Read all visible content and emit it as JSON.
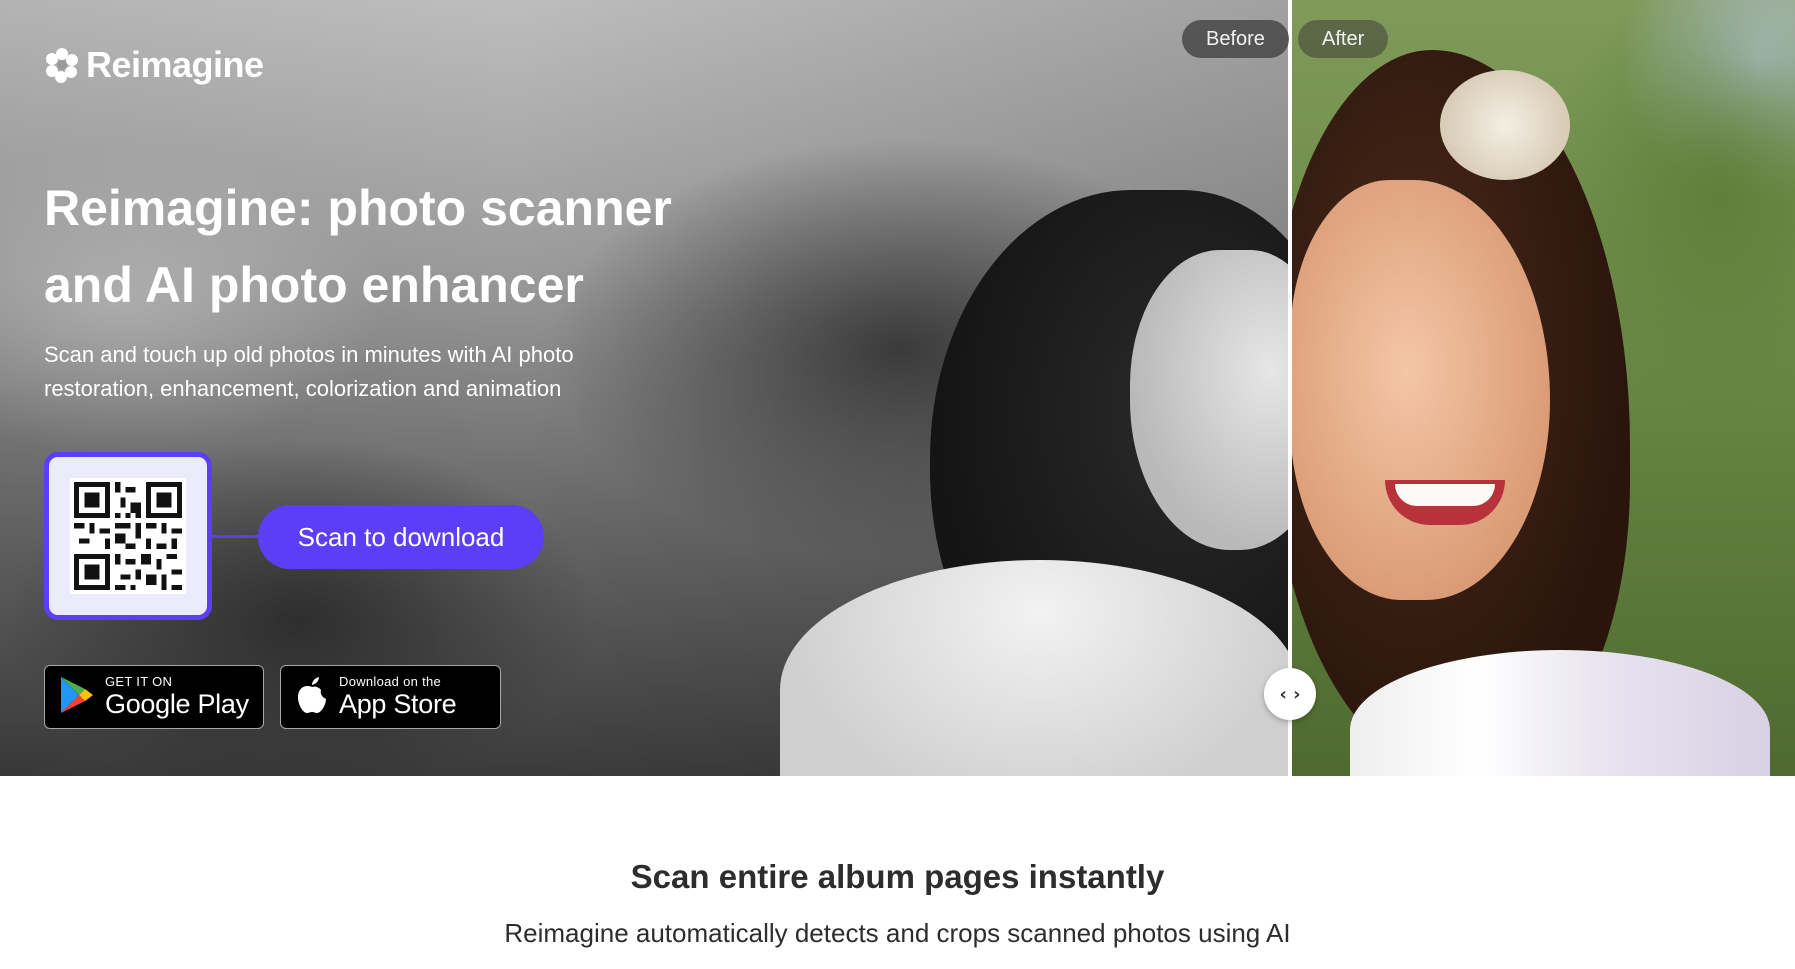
{
  "brand": {
    "name": "Reimagine"
  },
  "hero": {
    "title_line1": "Reimagine: photo scanner",
    "title_line2": "and AI photo enhancer",
    "subtitle_line1": "Scan and touch up old photos in minutes with AI photo",
    "subtitle_line2": "restoration, enhancement, colorization and animation",
    "scan_button": "Scan to download",
    "compare": {
      "before_label": "Before",
      "after_label": "After",
      "handle_icon": "left-right-arrows-icon"
    }
  },
  "store_badges": {
    "google": {
      "small": "GET IT ON",
      "big": "Google Play"
    },
    "apple": {
      "small": "Download on the",
      "big": "App Store"
    }
  },
  "section": {
    "title": "Scan entire album pages instantly",
    "subtitle": "Reimagine automatically detects and crops scanned photos using AI"
  },
  "colors": {
    "accent": "#5b3ef5",
    "text_dark": "#2d2d2d"
  }
}
